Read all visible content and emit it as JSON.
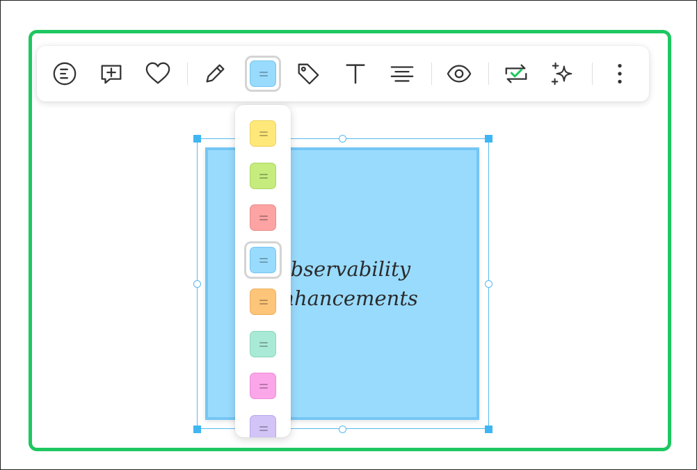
{
  "toolbar": {
    "buttons": [
      {
        "name": "outline-icon"
      },
      {
        "name": "add-comment-icon"
      },
      {
        "name": "heart-icon"
      },
      {
        "name": "pen-icon"
      },
      {
        "name": "sticky-color-icon"
      },
      {
        "name": "tag-icon"
      },
      {
        "name": "text-icon"
      },
      {
        "name": "align-center-icon"
      },
      {
        "name": "eye-icon"
      },
      {
        "name": "convert-icon"
      },
      {
        "name": "sparkle-icon"
      },
      {
        "name": "more-vertical-icon"
      }
    ],
    "current_color": "#99dbfd"
  },
  "color_dropdown": {
    "colors": [
      {
        "fill": "#ffe87a",
        "border": "#ecd25c"
      },
      {
        "fill": "#c6ec7e",
        "border": "#a9d65e"
      },
      {
        "fill": "#fda3a3",
        "border": "#e78a8a"
      },
      {
        "fill": "#99dbfd",
        "border": "#72c4ef",
        "selected": true
      },
      {
        "fill": "#fdc579",
        "border": "#eeae5a"
      },
      {
        "fill": "#a9ead6",
        "border": "#89d5bd"
      },
      {
        "fill": "#fca6ea",
        "border": "#ea8ad6"
      },
      {
        "fill": "#d2c4f7",
        "border": "#b8a7ea"
      }
    ]
  },
  "sticky_note": {
    "text": "Observability\nEnhancements",
    "color": "#99dbfd"
  },
  "accent": "#1ec761"
}
